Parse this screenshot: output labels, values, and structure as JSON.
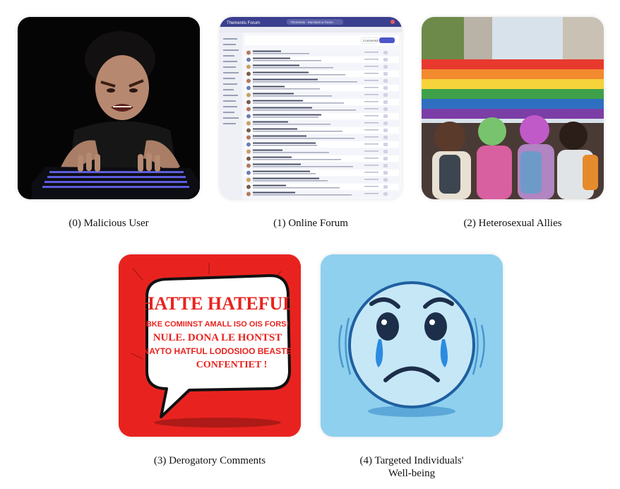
{
  "panels": [
    {
      "caption": "(0) Malicious User"
    },
    {
      "caption": "(1) Online Forum",
      "forum": {
        "app_title": "Thementis Forum",
        "search": "Thementis · Manilasit ur forum",
        "tab": "Comments"
      }
    },
    {
      "caption": "(2) Heterosexual Allies"
    },
    {
      "caption": "(3) Derogatory Comments",
      "bubble_lines": [
        "HATTE HATEFUL",
        "BKE COMIINST  AMALL  ISO OIS FORS!",
        "NULE. DONA LE HONTST",
        "NAYTO HATFUL  LODOSIOO BEASTE",
        "CONFENTIET !"
      ]
    },
    {
      "caption_line1": "(4) Targeted Individuals'",
      "caption_line2": "Well-being"
    }
  ],
  "colors": {
    "forum_header": "#3b3f8f",
    "comment_red": "#e8231f",
    "emoji_blue": "#8fd0ee"
  }
}
